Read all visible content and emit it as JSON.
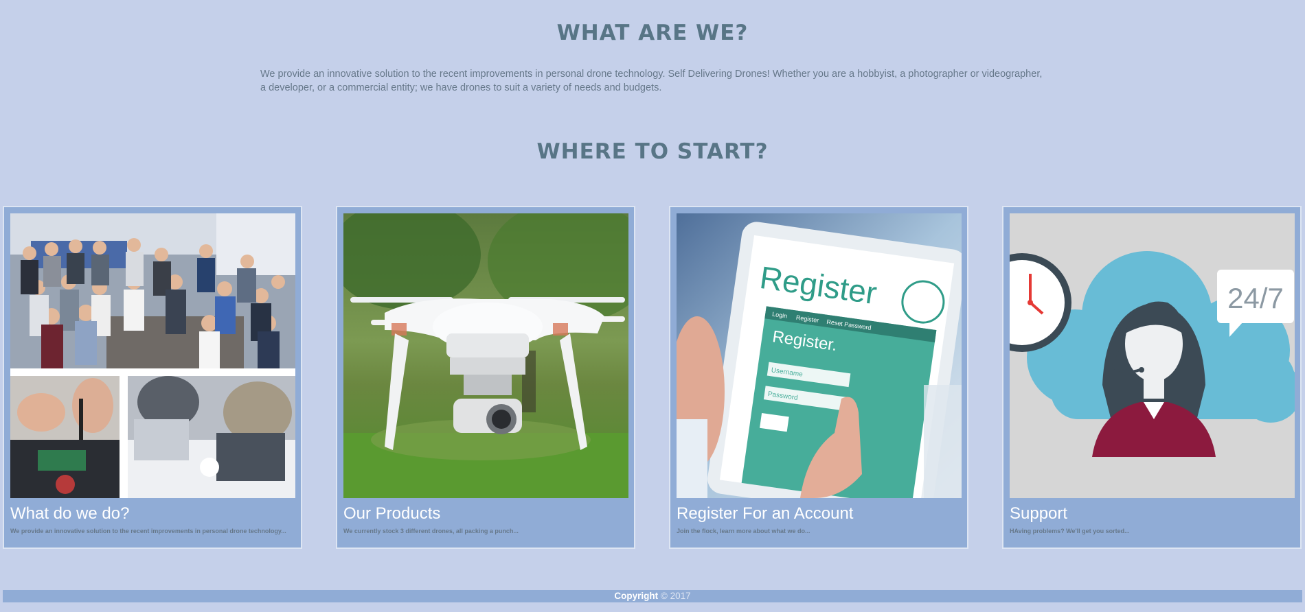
{
  "about": {
    "heading": "WHAT ARE WE?",
    "text": "We provide an innovative solution to the recent improvements in personal drone technology. Self Delivering Drones! Whether you are a hobbyist, a photographer or videographer, a developer, or a commercial entity; we have drones to suit a variety of needs and budgets."
  },
  "start": {
    "heading": "WHERE TO START?"
  },
  "cards": [
    {
      "title": "What do we do?",
      "desc": "We provide an innovative solution to the recent improvements in personal drone technology...",
      "icon": "team-photo"
    },
    {
      "title": "Our Products",
      "desc": "We currently stock 3 different drones, all packing a punch...",
      "icon": "drone-photo"
    },
    {
      "title": "Register For an Account",
      "desc": "Join the flock, learn more about what we do...",
      "icon": "register-tablet-photo",
      "image_text": {
        "register": "Register",
        "register_small": "Register.",
        "username": "Username",
        "password": "Password",
        "tab_login": "Login",
        "tab_register": "Register",
        "tab_reset": "Reset Password"
      }
    },
    {
      "title": "Support",
      "desc": "HAving problems? We'll get you sorted...",
      "icon": "support-agent-illustration",
      "image_text": {
        "badge": "24/7"
      }
    }
  ],
  "footer": {
    "strong": "Copyright",
    "rest": " © 2017"
  },
  "colors": {
    "background": "#c5d0ea",
    "card": "#90acd6",
    "heading": "#587586",
    "body_text": "#66788a"
  }
}
